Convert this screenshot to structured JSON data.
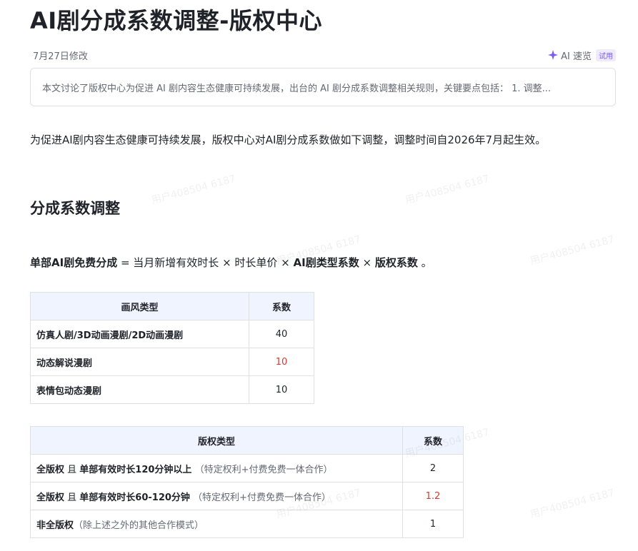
{
  "doc": {
    "title": "AI剧分成系数调整-版权中心",
    "modified": "7月27日修改",
    "ai_quick": {
      "label": "AI 速览",
      "badge": "试用",
      "icon": "sparkle-icon"
    },
    "summary": "本文讨论了版权中心为促进 AI 剧内容生态健康可持续发展，出台的 AI 剧分成系数调整相关规则，关键要点包括： 1. 调整...",
    "intro": "为促进AI剧内容生态健康可持续发展，版权中心对AI剧分成系数做如下调整，调整时间自2026年7月起生效。",
    "section_heading": "分成系数调整",
    "formula": {
      "lhs": "单部AI剧免费分成",
      "eq": " = 当月新增有效时长 × 时长单价 × ",
      "term1": "AI剧类型系数",
      "times": " × ",
      "term2": "版权系数",
      "end": " 。"
    }
  },
  "style_table": {
    "headers": [
      "画风类型",
      "系数"
    ],
    "rows": [
      {
        "type": "仿真人剧/3D动画漫剧/2D动画漫剧",
        "coef": "40"
      },
      {
        "type": "动态解说漫剧",
        "coef": "10"
      },
      {
        "type": "表情包动态漫剧",
        "coef": "10"
      }
    ]
  },
  "copyright_table": {
    "headers": [
      "版权类型",
      "系数"
    ],
    "rows": [
      {
        "bold1": "全版权",
        "mid": " 且 ",
        "bold2": "单部有效时长120分钟以上",
        "note": "（特定权利+付费免费一体合作）",
        "coef": "2"
      },
      {
        "bold1": "全版权",
        "mid": " 且 ",
        "bold2": "单部有效时长60-120分钟",
        "note": "（特定权利+付费免费一体合作）",
        "coef": "1.2"
      },
      {
        "bold1": "非全版权",
        "mid": "",
        "bold2": "",
        "note": "（除上述之外的其他合作模式）",
        "coef": "1"
      }
    ]
  },
  "watermark": "用户408504 6187",
  "colors": {
    "accent_red": "#d83931",
    "header_bg": "#f0f4ff",
    "ai_purple": "#7a5af8"
  }
}
